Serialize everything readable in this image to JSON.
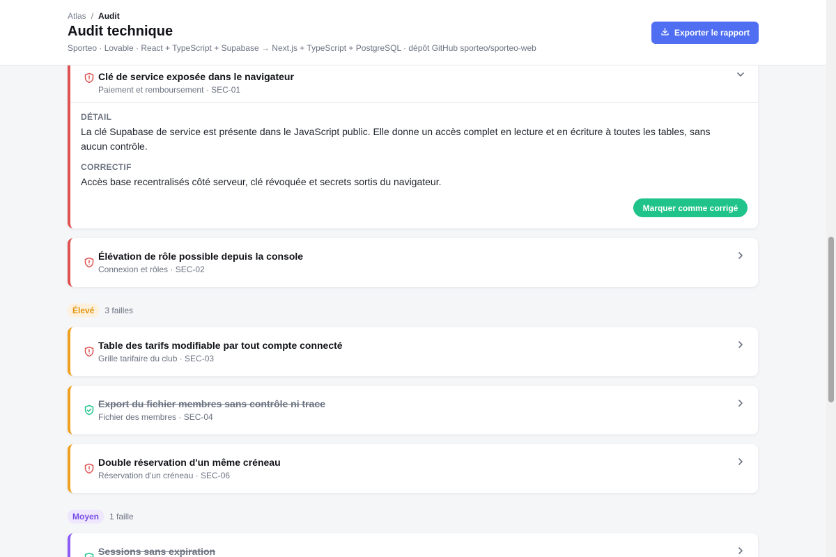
{
  "header": {
    "breadcrumb": {
      "root": "Atlas",
      "separator": "/",
      "current": "Audit"
    },
    "title": "Audit technique",
    "subtitle": "Sporteo · Lovable · React + TypeScript + Supabase → Next.js + TypeScript + PostgreSQL · dépôt GitHub sporteo/sporteo-web",
    "export_label": "Exporter le rapport",
    "export_icon": "download-icon"
  },
  "colors": {
    "accent": "#4f6ef2",
    "critical": "#e05252",
    "high": "#f0a020",
    "medium": "#8b5cf6",
    "fixed": "#20c48a"
  },
  "expanded_finding": {
    "title": "Clé de service exposée dans le navigateur",
    "meta": "Paiement et remboursement · SEC-01",
    "status": "open",
    "detail_label": "DÉTAIL",
    "detail_text": "La clé Supabase de service est présente dans le JavaScript public. Elle donne un accès complet en lecture et en écriture à toutes les tables, sans aucun contrôle.",
    "fix_label": "CORRECTIF",
    "fix_text": "Accès base recentralisés côté serveur, clé révoquée et secrets sortis du navigateur.",
    "mark_fixed_label": "Marquer comme corrigé"
  },
  "critical_findings": [
    {
      "title": "Élévation de rôle possible depuis la console",
      "meta": "Connexion et rôles · SEC-02",
      "status": "open"
    }
  ],
  "groups": [
    {
      "severity": "Élevé",
      "count": "3 failles",
      "findings": [
        {
          "title": "Table des tarifs modifiable par tout compte connecté",
          "meta": "Grille tarifaire du club · SEC-03",
          "status": "open"
        },
        {
          "title": "Export du fichier membres sans contrôle ni trace",
          "meta": "Fichier des membres · SEC-04",
          "status": "fixed"
        },
        {
          "title": "Double réservation d'un même créneau",
          "meta": "Réservation d'un créneau · SEC-06",
          "status": "open"
        }
      ]
    },
    {
      "severity": "Moyen",
      "count": "1 faille",
      "findings": [
        {
          "title": "Sessions sans expiration",
          "meta": "",
          "status": "fixed"
        }
      ]
    }
  ]
}
